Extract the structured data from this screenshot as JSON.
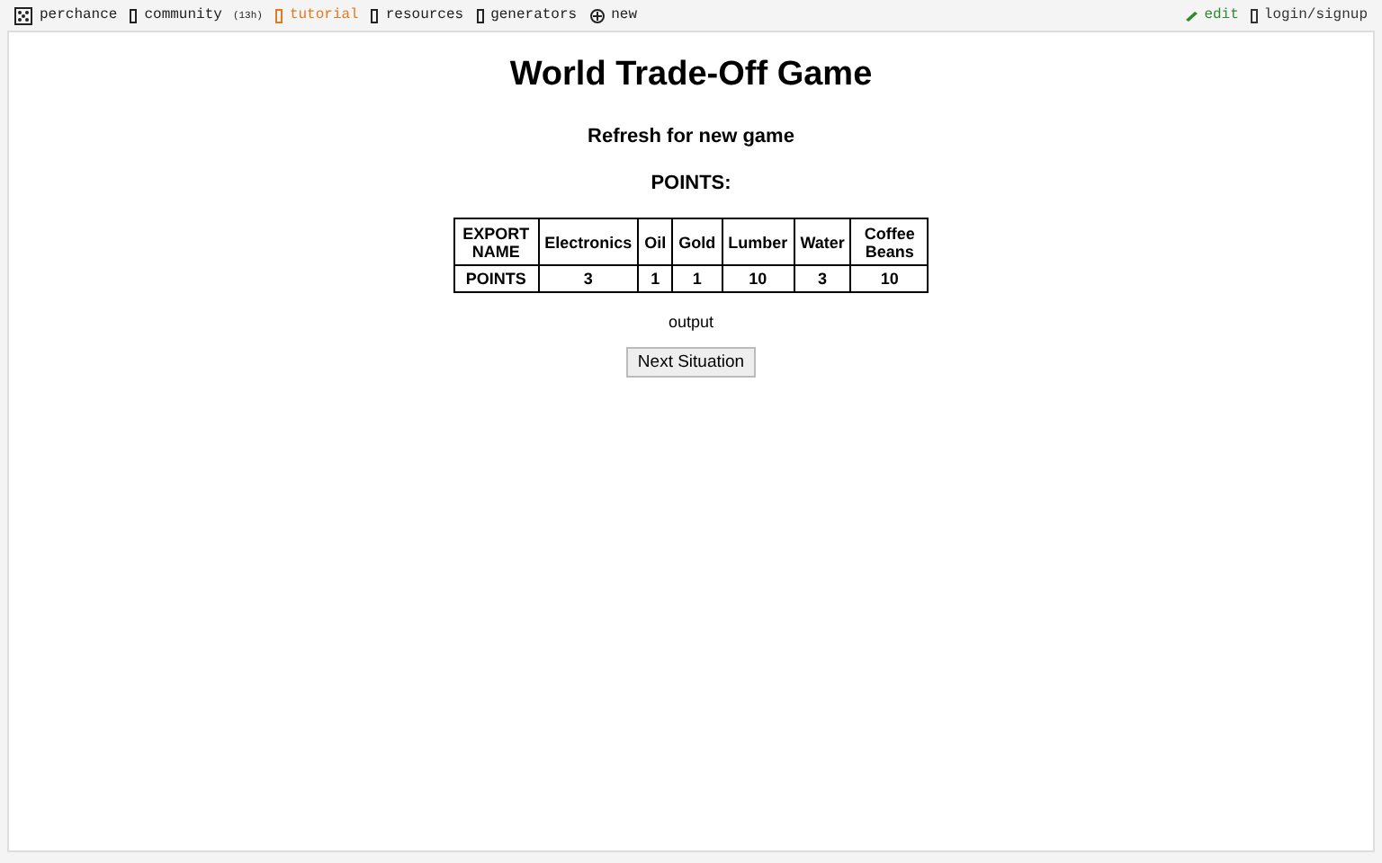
{
  "top_bar": {
    "left_links": [
      {
        "label": "perchance",
        "kind": "dice",
        "highlighted": false
      },
      {
        "label": "community",
        "note": "(13h)",
        "kind": "box",
        "highlighted": false
      },
      {
        "label": "tutorial",
        "kind": "box",
        "highlighted": true
      },
      {
        "label": "resources",
        "kind": "box",
        "highlighted": false
      },
      {
        "label": "generators",
        "kind": "box",
        "highlighted": false
      },
      {
        "label": "new",
        "kind": "plus",
        "highlighted": false
      }
    ],
    "right_links": [
      {
        "label": "edit",
        "kind": "pencil",
        "color": "#2e8b2e"
      },
      {
        "label": "login/signup",
        "kind": "box",
        "color": "#333333"
      }
    ]
  },
  "page": {
    "title": "World Trade-Off Game",
    "subtitle": "Refresh for new game",
    "points_label": "POINTS:",
    "table": {
      "header": [
        "EXPORT NAME",
        "Electronics",
        "Oil",
        "Gold",
        "Lumber",
        "Water",
        "Coffee Beans"
      ],
      "rows": [
        [
          "POINTS",
          "3",
          "1",
          "1",
          "10",
          "3",
          "10"
        ]
      ]
    },
    "output": "output",
    "button": "Next Situation"
  }
}
